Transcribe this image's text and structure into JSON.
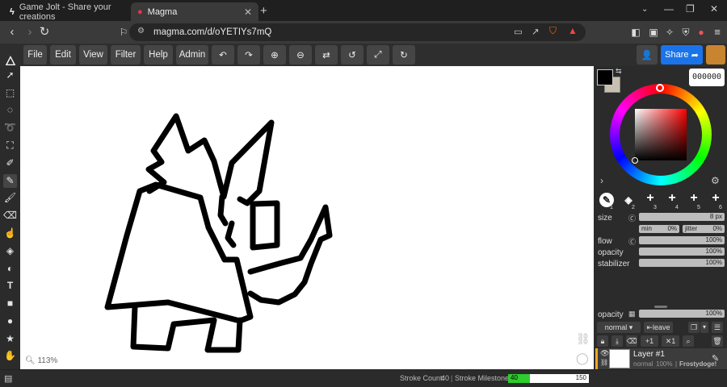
{
  "browser": {
    "tabs": [
      {
        "title": "Game Jolt - Share your creations",
        "active": false
      },
      {
        "title": "Magma",
        "active": true
      }
    ],
    "url": "magma.com/d/oYETIYs7mQ"
  },
  "menu": [
    "File",
    "Edit",
    "View",
    "Filter",
    "Help",
    "Admin"
  ],
  "share_label": "Share",
  "color": {
    "hex_display": "000000",
    "primary": "#000000",
    "secondary": "#c8bfae"
  },
  "brush_slots": [
    "1",
    "2",
    "3",
    "4",
    "5",
    "6"
  ],
  "brush": {
    "size_label": "size",
    "size_value": "8 px",
    "min_label": "min",
    "min_value": "0%",
    "jitter_label": "jitter",
    "jitter_value": "0%",
    "flow_label": "flow",
    "flow_value": "100%",
    "opacity_label": "opacity",
    "opacity_value": "100%",
    "stabilizer_label": "stabilizer",
    "stabilizer_value": "100%"
  },
  "layers": {
    "opacity_label": "opacity",
    "opacity_value": "100%",
    "blend_mode": "normal",
    "leave_label": "leave",
    "merge_label": "1",
    "clip_label": "1",
    "items": [
      {
        "name": "Layer #1",
        "mode": "normal",
        "opacity": "100%",
        "owner": "Frostydoge!"
      }
    ]
  },
  "zoom": "113%",
  "status": {
    "stroke_count_label": "Stroke Count:",
    "stroke_count": "40",
    "milestone_label": "Stroke Milestone:",
    "milestone_current": "40",
    "milestone_target": "150",
    "milestone_fraction": 0.27
  }
}
